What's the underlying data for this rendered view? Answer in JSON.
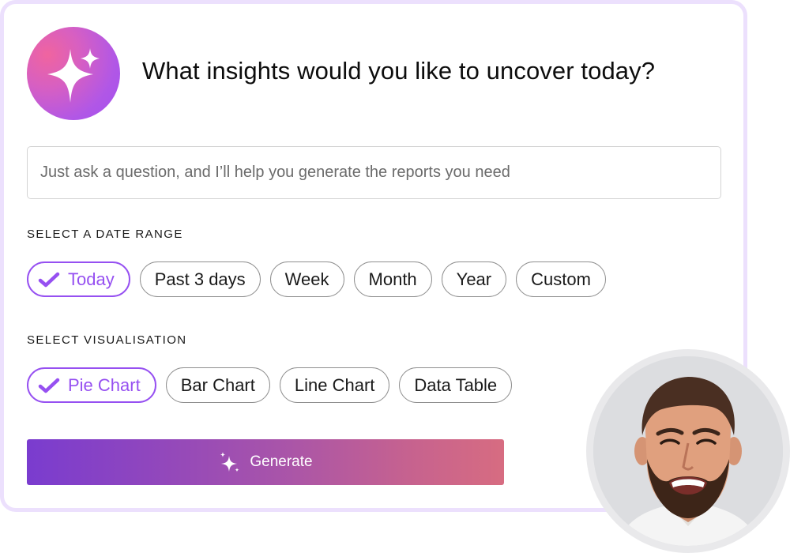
{
  "header": {
    "logo_icon": "sparkles-icon",
    "title": "What insights would you like to uncover today?"
  },
  "query": {
    "value": "",
    "placeholder": "Just ask a question, and I’ll help you generate the reports you need"
  },
  "date_range": {
    "label": "SELECT A DATE RANGE",
    "options": [
      {
        "label": "Today",
        "selected": true
      },
      {
        "label": "Past 3 days",
        "selected": false
      },
      {
        "label": "Week",
        "selected": false
      },
      {
        "label": "Month",
        "selected": false
      },
      {
        "label": "Year",
        "selected": false
      },
      {
        "label": "Custom",
        "selected": false
      }
    ]
  },
  "visualisation": {
    "label": "SELECT VISUALISATION",
    "options": [
      {
        "label": "Pie Chart",
        "selected": true
      },
      {
        "label": "Bar Chart",
        "selected": false
      },
      {
        "label": "Line Chart",
        "selected": false
      },
      {
        "label": "Data Table",
        "selected": false
      }
    ]
  },
  "generate": {
    "label": "Generate",
    "icon": "sparkles-icon"
  },
  "avatar": {
    "description": "smiling bearded man"
  },
  "colors": {
    "accent": "#9650f1",
    "card_border": "#ece0fd",
    "button_gradient_start": "#7a3ccf",
    "button_gradient_end": "#d76c81"
  }
}
